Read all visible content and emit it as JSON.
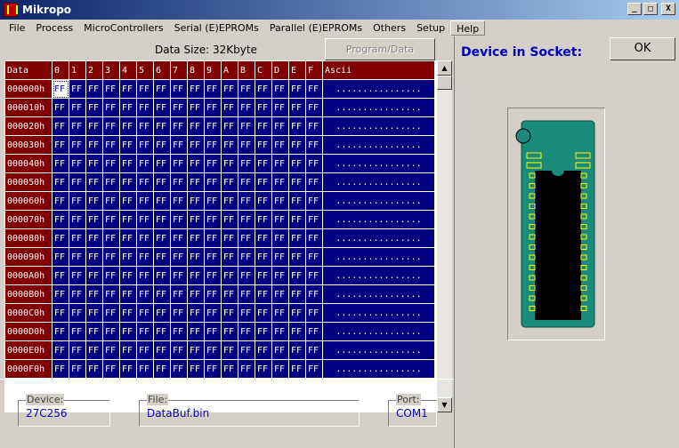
{
  "window": {
    "title": "Mikropo",
    "buttons": {
      "minimize": "_",
      "maximize": "□",
      "close": "X"
    }
  },
  "menu": [
    "File",
    "Process",
    "MicroControllers",
    "Serial (E)EPROMs",
    "Parallel (E)EPROMs",
    "Others",
    "Setup",
    "Help"
  ],
  "toolbar": {
    "data_size": "Data Size: 32Kbyte",
    "program_label": "Program/Data"
  },
  "grid": {
    "headers": [
      "Data",
      "0",
      "1",
      "2",
      "3",
      "4",
      "5",
      "6",
      "7",
      "8",
      "9",
      "A",
      "B",
      "C",
      "D",
      "E",
      "F",
      "Ascii"
    ],
    "addresses": [
      "000000h",
      "000010h",
      "000020h",
      "000030h",
      "000040h",
      "000050h",
      "000060h",
      "000070h",
      "000080h",
      "000090h",
      "0000A0h",
      "0000B0h",
      "0000C0h",
      "0000D0h",
      "0000E0h",
      "0000F0h"
    ],
    "cell_value": "FF",
    "ascii_value": "................"
  },
  "device_panel": {
    "title": "Device in Socket:",
    "ok_label": "OK"
  },
  "status": {
    "device_label": "Device:",
    "device_value": "27C256",
    "file_label": "File:",
    "file_value": "DataBuf.bin",
    "port_label": "Port:",
    "port_value": "COM1"
  },
  "colors": {
    "header_bg": "#800000",
    "cell_bg": "#000080",
    "accent": "#0000c0",
    "pcb": "#1a8a7a"
  }
}
